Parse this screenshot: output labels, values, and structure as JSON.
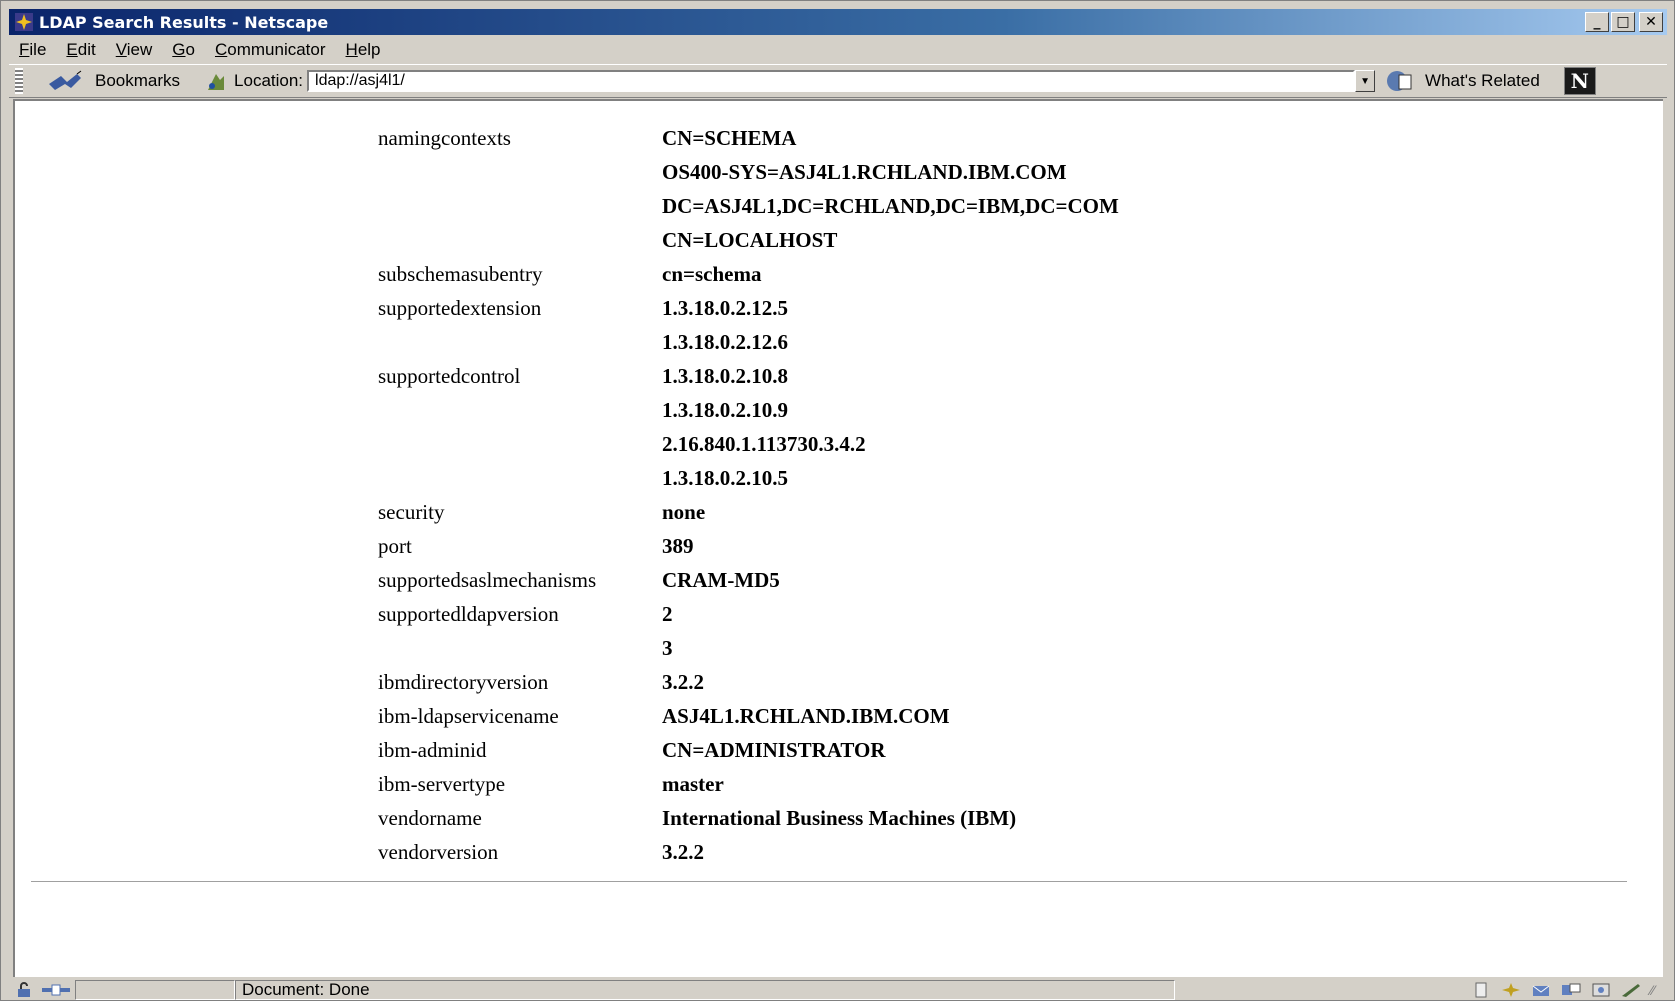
{
  "window": {
    "title": "LDAP Search Results - Netscape"
  },
  "menu": [
    {
      "label": "File",
      "accel": "F",
      "rest": "ile"
    },
    {
      "label": "Edit",
      "accel": "E",
      "rest": "dit"
    },
    {
      "label": "View",
      "accel": "V",
      "rest": "iew"
    },
    {
      "label": "Go",
      "accel": "G",
      "rest": "o"
    },
    {
      "label": "Communicator",
      "accel": "C",
      "rest": "ommunicator"
    },
    {
      "label": "Help",
      "accel": "H",
      "rest": "elp"
    }
  ],
  "toolbar": {
    "bookmarks_label": "Bookmarks",
    "location_label": "Location:",
    "location_value": "ldap://asj4l1/",
    "whats_related_label": "What's Related"
  },
  "results": [
    {
      "attr": "namingcontexts",
      "value": "CN=SCHEMA"
    },
    {
      "attr": "",
      "value": "OS400-SYS=ASJ4L1.RCHLAND.IBM.COM"
    },
    {
      "attr": "",
      "value": "DC=ASJ4L1,DC=RCHLAND,DC=IBM,DC=COM"
    },
    {
      "attr": "",
      "value": "CN=LOCALHOST"
    },
    {
      "attr": "subschemasubentry",
      "value": "cn=schema"
    },
    {
      "attr": "supportedextension",
      "value": "1.3.18.0.2.12.5"
    },
    {
      "attr": "",
      "value": "1.3.18.0.2.12.6"
    },
    {
      "attr": "supportedcontrol",
      "value": "1.3.18.0.2.10.8"
    },
    {
      "attr": "",
      "value": "1.3.18.0.2.10.9"
    },
    {
      "attr": "",
      "value": "2.16.840.1.113730.3.4.2"
    },
    {
      "attr": "",
      "value": "1.3.18.0.2.10.5"
    },
    {
      "attr": "security",
      "value": "none"
    },
    {
      "attr": "port",
      "value": "389"
    },
    {
      "attr": "supportedsaslmechanisms",
      "value": "CRAM-MD5"
    },
    {
      "attr": "supportedldapversion",
      "value": "2"
    },
    {
      "attr": "",
      "value": "3"
    },
    {
      "attr": "ibmdirectoryversion",
      "value": "3.2.2"
    },
    {
      "attr": "ibm-ldapservicename",
      "value": "ASJ4L1.RCHLAND.IBM.COM"
    },
    {
      "attr": "ibm-adminid",
      "value": "CN=ADMINISTRATOR"
    },
    {
      "attr": "ibm-servertype",
      "value": "master"
    },
    {
      "attr": "vendorname",
      "value": "International Business Machines (IBM)"
    },
    {
      "attr": "vendorversion",
      "value": "3.2.2"
    }
  ],
  "status": {
    "text": "Document: Done"
  }
}
